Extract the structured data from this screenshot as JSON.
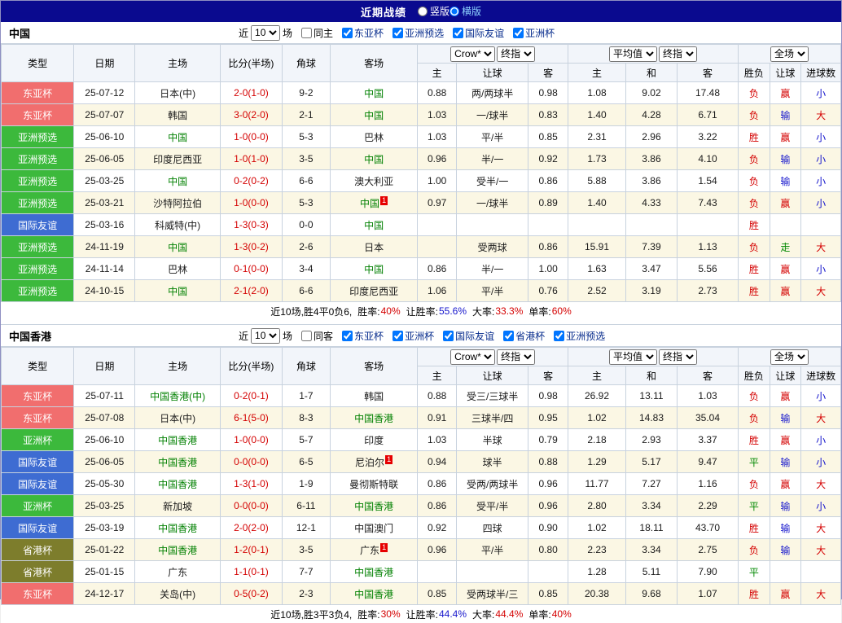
{
  "topbar": {
    "title": "近期战绩",
    "options": [
      {
        "label": "竖版",
        "selected": false
      },
      {
        "label": "横版",
        "selected": true
      }
    ]
  },
  "columns": {
    "main": [
      "类型",
      "日期",
      "主场",
      "比分(半场)",
      "角球",
      "客场"
    ],
    "sub": [
      "主",
      "让球",
      "客",
      "主",
      "和",
      "客",
      "胜负",
      "让球",
      "进球数"
    ]
  },
  "type_colors": {
    "东亚杯": "#f16e6e",
    "亚洲预选": "#3cb93c",
    "国际友谊": "#3e6cd2",
    "亚洲杯": "#3cb93c",
    "省港杯": "#7d7d2c"
  },
  "result_colors": {
    "胜": "#d40000",
    "负": "#d40000",
    "平": "#008800",
    "赢": "#d40000",
    "输": "#1515cc",
    "走": "#008800",
    "大": "#d40000",
    "小": "#1515cc"
  },
  "colors": {
    "topbar_bg": "#0a0a8f",
    "score": "#d40000",
    "team_highlight": "#008000",
    "sup_bg": "#e60000",
    "filter_label": "#062b8c",
    "alt_row": "#fbf7e4"
  },
  "sections": [
    {
      "id": "china",
      "name": "中国",
      "controls": {
        "near": "近",
        "count": "10",
        "matches": "场",
        "same": "同主",
        "same_checked": false,
        "filters": [
          {
            "label": "东亚杯",
            "checked": true
          },
          {
            "label": "亚洲预选",
            "checked": true
          },
          {
            "label": "国际友谊",
            "checked": true
          },
          {
            "label": "亚洲杯",
            "checked": true
          }
        ]
      },
      "selects": {
        "book": "Crow*",
        "book_time": "终指",
        "avg": "平均值",
        "avg_time": "终指",
        "scope": "全场"
      },
      "rows": [
        {
          "type": "东亚杯",
          "date": "25-07-12",
          "home": "日本(中)",
          "home_hl": false,
          "home_sup": "",
          "score": "2-0(1-0)",
          "corner": "9-2",
          "away": "中国",
          "away_hl": true,
          "away_sup": "",
          "asia": [
            "0.88",
            "两/两球半",
            "0.98"
          ],
          "euro": [
            "1.08",
            "9.02",
            "17.48"
          ],
          "result": [
            "负",
            "赢",
            "小"
          ]
        },
        {
          "type": "东亚杯",
          "date": "25-07-07",
          "home": "韩国",
          "home_hl": false,
          "home_sup": "",
          "score": "3-0(2-0)",
          "corner": "2-1",
          "away": "中国",
          "away_hl": true,
          "away_sup": "",
          "asia": [
            "1.03",
            "一/球半",
            "0.83"
          ],
          "euro": [
            "1.40",
            "4.28",
            "6.71"
          ],
          "result": [
            "负",
            "输",
            "大"
          ]
        },
        {
          "type": "亚洲预选",
          "date": "25-06-10",
          "home": "中国",
          "home_hl": true,
          "home_sup": "",
          "score": "1-0(0-0)",
          "corner": "5-3",
          "away": "巴林",
          "away_hl": false,
          "away_sup": "",
          "asia": [
            "1.03",
            "平/半",
            "0.85"
          ],
          "euro": [
            "2.31",
            "2.96",
            "3.22"
          ],
          "result": [
            "胜",
            "赢",
            "小"
          ]
        },
        {
          "type": "亚洲预选",
          "date": "25-06-05",
          "home": "印度尼西亚",
          "home_hl": false,
          "home_sup": "",
          "score": "1-0(1-0)",
          "corner": "3-5",
          "away": "中国",
          "away_hl": true,
          "away_sup": "",
          "asia": [
            "0.96",
            "半/一",
            "0.92"
          ],
          "euro": [
            "1.73",
            "3.86",
            "4.10"
          ],
          "result": [
            "负",
            "输",
            "小"
          ]
        },
        {
          "type": "亚洲预选",
          "date": "25-03-25",
          "home": "中国",
          "home_hl": true,
          "home_sup": "",
          "score": "0-2(0-2)",
          "corner": "6-6",
          "away": "澳大利亚",
          "away_hl": false,
          "away_sup": "",
          "asia": [
            "1.00",
            "受半/一",
            "0.86"
          ],
          "euro": [
            "5.88",
            "3.86",
            "1.54"
          ],
          "result": [
            "负",
            "输",
            "小"
          ]
        },
        {
          "type": "亚洲预选",
          "date": "25-03-21",
          "home": "沙特阿拉伯",
          "home_hl": false,
          "home_sup": "",
          "score": "1-0(0-0)",
          "corner": "5-3",
          "away": "中国",
          "away_hl": true,
          "away_sup": "1",
          "asia": [
            "0.97",
            "一/球半",
            "0.89"
          ],
          "euro": [
            "1.40",
            "4.33",
            "7.43"
          ],
          "result": [
            "负",
            "赢",
            "小"
          ]
        },
        {
          "type": "国际友谊",
          "date": "25-03-16",
          "home": "科威特(中)",
          "home_hl": false,
          "home_sup": "",
          "score": "1-3(0-3)",
          "corner": "0-0",
          "away": "中国",
          "away_hl": true,
          "away_sup": "",
          "asia": [
            "",
            "",
            ""
          ],
          "euro": [
            "",
            "",
            ""
          ],
          "result": [
            "胜",
            "",
            ""
          ]
        },
        {
          "type": "亚洲预选",
          "date": "24-11-19",
          "home": "中国",
          "home_hl": true,
          "home_sup": "",
          "score": "1-3(0-2)",
          "corner": "2-6",
          "away": "日本",
          "away_hl": false,
          "away_sup": "",
          "asia": [
            "",
            "受两球",
            "0.86"
          ],
          "euro": [
            "15.91",
            "7.39",
            "1.13"
          ],
          "result": [
            "负",
            "走",
            "大"
          ]
        },
        {
          "type": "亚洲预选",
          "date": "24-11-14",
          "home": "巴林",
          "home_hl": false,
          "home_sup": "",
          "score": "0-1(0-0)",
          "corner": "3-4",
          "away": "中国",
          "away_hl": true,
          "away_sup": "",
          "asia": [
            "0.86",
            "半/一",
            "1.00"
          ],
          "euro": [
            "1.63",
            "3.47",
            "5.56"
          ],
          "result": [
            "胜",
            "赢",
            "小"
          ]
        },
        {
          "type": "亚洲预选",
          "date": "24-10-15",
          "home": "中国",
          "home_hl": true,
          "home_sup": "",
          "score": "2-1(2-0)",
          "corner": "6-6",
          "away": "印度尼西亚",
          "away_hl": false,
          "away_sup": "",
          "asia": [
            "1.06",
            "平/半",
            "0.76"
          ],
          "euro": [
            "2.52",
            "3.19",
            "2.73"
          ],
          "result": [
            "胜",
            "赢",
            "大"
          ]
        }
      ],
      "summary": {
        "record": "近10场,胜4平0负6,",
        "stats": [
          {
            "label": "胜率:",
            "value": "40%",
            "color": "#d40000"
          },
          {
            "label": "让胜率:",
            "value": "55.6%",
            "color": "#1515cc"
          },
          {
            "label": "大率:",
            "value": "33.3%",
            "color": "#d40000"
          },
          {
            "label": "单率:",
            "value": "60%",
            "color": "#d40000"
          }
        ]
      }
    },
    {
      "id": "hongkong",
      "name": "中国香港",
      "controls": {
        "near": "近",
        "count": "10",
        "matches": "场",
        "same": "同客",
        "same_checked": false,
        "filters": [
          {
            "label": "东亚杯",
            "checked": true
          },
          {
            "label": "亚洲杯",
            "checked": true
          },
          {
            "label": "国际友谊",
            "checked": true
          },
          {
            "label": "省港杯",
            "checked": true
          },
          {
            "label": "亚洲预选",
            "checked": true
          }
        ]
      },
      "selects": {
        "book": "Crow*",
        "book_time": "终指",
        "avg": "平均值",
        "avg_time": "终指",
        "scope": "全场"
      },
      "rows": [
        {
          "type": "东亚杯",
          "date": "25-07-11",
          "home": "中国香港(中)",
          "home_hl": true,
          "home_sup": "",
          "score": "0-2(0-1)",
          "corner": "1-7",
          "away": "韩国",
          "away_hl": false,
          "away_sup": "",
          "asia": [
            "0.88",
            "受三/三球半",
            "0.98"
          ],
          "euro": [
            "26.92",
            "13.11",
            "1.03"
          ],
          "result": [
            "负",
            "赢",
            "小"
          ]
        },
        {
          "type": "东亚杯",
          "date": "25-07-08",
          "home": "日本(中)",
          "home_hl": false,
          "home_sup": "",
          "score": "6-1(5-0)",
          "corner": "8-3",
          "away": "中国香港",
          "away_hl": true,
          "away_sup": "",
          "asia": [
            "0.91",
            "三球半/四",
            "0.95"
          ],
          "euro": [
            "1.02",
            "14.83",
            "35.04"
          ],
          "result": [
            "负",
            "输",
            "大"
          ]
        },
        {
          "type": "亚洲杯",
          "date": "25-06-10",
          "home": "中国香港",
          "home_hl": true,
          "home_sup": "",
          "score": "1-0(0-0)",
          "corner": "5-7",
          "away": "印度",
          "away_hl": false,
          "away_sup": "",
          "asia": [
            "1.03",
            "半球",
            "0.79"
          ],
          "euro": [
            "2.18",
            "2.93",
            "3.37"
          ],
          "result": [
            "胜",
            "赢",
            "小"
          ]
        },
        {
          "type": "国际友谊",
          "date": "25-06-05",
          "home": "中国香港",
          "home_hl": true,
          "home_sup": "",
          "score": "0-0(0-0)",
          "corner": "6-5",
          "away": "尼泊尔",
          "away_hl": false,
          "away_sup": "1",
          "asia": [
            "0.94",
            "球半",
            "0.88"
          ],
          "euro": [
            "1.29",
            "5.17",
            "9.47"
          ],
          "result": [
            "平",
            "输",
            "小"
          ]
        },
        {
          "type": "国际友谊",
          "date": "25-05-30",
          "home": "中国香港",
          "home_hl": true,
          "home_sup": "",
          "score": "1-3(1-0)",
          "corner": "1-9",
          "away": "曼彻斯特联",
          "away_hl": false,
          "away_sup": "",
          "asia": [
            "0.86",
            "受两/两球半",
            "0.96"
          ],
          "euro": [
            "11.77",
            "7.27",
            "1.16"
          ],
          "result": [
            "负",
            "赢",
            "大"
          ]
        },
        {
          "type": "亚洲杯",
          "date": "25-03-25",
          "home": "新加坡",
          "home_hl": false,
          "home_sup": "",
          "score": "0-0(0-0)",
          "corner": "6-11",
          "away": "中国香港",
          "away_hl": true,
          "away_sup": "",
          "asia": [
            "0.86",
            "受平/半",
            "0.96"
          ],
          "euro": [
            "2.80",
            "3.34",
            "2.29"
          ],
          "result": [
            "平",
            "输",
            "小"
          ]
        },
        {
          "type": "国际友谊",
          "date": "25-03-19",
          "home": "中国香港",
          "home_hl": true,
          "home_sup": "",
          "score": "2-0(2-0)",
          "corner": "12-1",
          "away": "中国澳门",
          "away_hl": false,
          "away_sup": "",
          "asia": [
            "0.92",
            "四球",
            "0.90"
          ],
          "euro": [
            "1.02",
            "18.11",
            "43.70"
          ],
          "result": [
            "胜",
            "输",
            "大"
          ]
        },
        {
          "type": "省港杯",
          "date": "25-01-22",
          "home": "中国香港",
          "home_hl": true,
          "home_sup": "",
          "score": "1-2(0-1)",
          "corner": "3-5",
          "away": "广东",
          "away_hl": false,
          "away_sup": "1",
          "asia": [
            "0.96",
            "平/半",
            "0.80"
          ],
          "euro": [
            "2.23",
            "3.34",
            "2.75"
          ],
          "result": [
            "负",
            "输",
            "大"
          ]
        },
        {
          "type": "省港杯",
          "date": "25-01-15",
          "home": "广东",
          "home_hl": false,
          "home_sup": "",
          "score": "1-1(0-1)",
          "corner": "7-7",
          "away": "中国香港",
          "away_hl": true,
          "away_sup": "",
          "asia": [
            "",
            "",
            ""
          ],
          "euro": [
            "1.28",
            "5.11",
            "7.90"
          ],
          "result": [
            "平",
            "",
            ""
          ]
        },
        {
          "type": "东亚杯",
          "date": "24-12-17",
          "home": "关岛(中)",
          "home_hl": false,
          "home_sup": "",
          "score": "0-5(0-2)",
          "corner": "2-3",
          "away": "中国香港",
          "away_hl": true,
          "away_sup": "",
          "asia": [
            "0.85",
            "受两球半/三",
            "0.85"
          ],
          "euro": [
            "20.38",
            "9.68",
            "1.07"
          ],
          "result": [
            "胜",
            "赢",
            "大"
          ]
        }
      ],
      "summary": {
        "record": "近10场,胜3平3负4,",
        "stats": [
          {
            "label": "胜率:",
            "value": "30%",
            "color": "#d40000"
          },
          {
            "label": "让胜率:",
            "value": "44.4%",
            "color": "#1515cc"
          },
          {
            "label": "大率:",
            "value": "44.4%",
            "color": "#d40000"
          },
          {
            "label": "单率:",
            "value": "40%",
            "color": "#d40000"
          }
        ]
      }
    }
  ]
}
